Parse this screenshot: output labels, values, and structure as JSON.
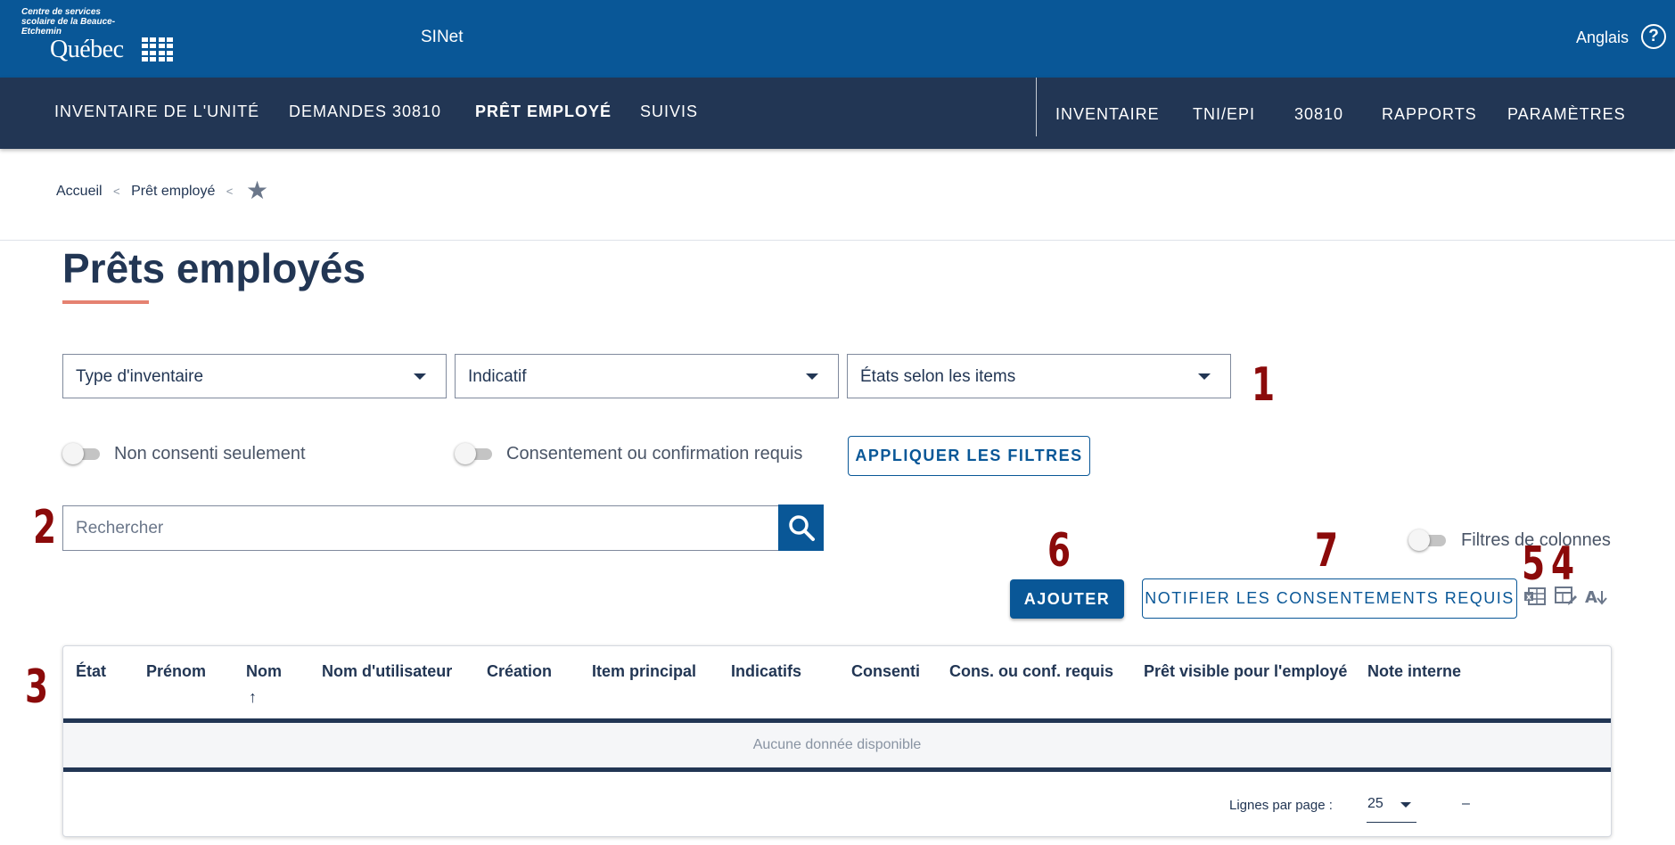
{
  "header": {
    "org_small": "Centre de services scolaire de la Beauce-Etchemin",
    "org_brand": "Québec",
    "app_title": "SINet",
    "language": "Anglais",
    "help_icon": "?"
  },
  "nav": {
    "left": [
      "INVENTAIRE DE L'UNITÉ",
      "DEMANDES 30810",
      "PRÊT EMPLOYÉ",
      "SUIVIS"
    ],
    "right": [
      "INVENTAIRE",
      "TNI/EPI",
      "30810",
      "RAPPORTS",
      "PARAMÈTRES"
    ],
    "active": "PRÊT EMPLOYÉ"
  },
  "breadcrumb": {
    "items": [
      "Accueil",
      "Prêt employé"
    ],
    "separator": "<",
    "star_icon": "★"
  },
  "page": {
    "title": "Prêts employés"
  },
  "filters": {
    "selects": [
      "Type d'inventaire",
      "Indicatif",
      "États selon les items"
    ],
    "toggle_non_consenti": "Non consenti seulement",
    "toggle_consentement": "Consentement ou confirmation requis",
    "apply_button": "APPLIQUER LES FILTRES"
  },
  "search": {
    "placeholder": "Rechercher"
  },
  "column_filters_label": "Filtres de colonnes",
  "actions": {
    "add_button": "AJOUTER",
    "notify_button": "NOTIFIER LES CONSENTEMENTS REQUIS"
  },
  "annotations": [
    "1",
    "2",
    "3",
    "4",
    "5",
    "6",
    "7"
  ],
  "table": {
    "columns": [
      "État",
      "Prénom",
      "Nom",
      "Nom d'utilisateur",
      "Création",
      "Item principal",
      "Indicatifs",
      "Consenti",
      "Cons. ou conf. requis",
      "Prêt visible pour l'employé",
      "Note interne"
    ],
    "sort_arrow": "↑",
    "empty_message": "Aucune donnée disponible",
    "rows_per_page_label": "Lignes par page :",
    "rows_per_page": "25",
    "range": "–"
  },
  "colors": {
    "header_blue": "#095797",
    "nav_dark": "#223654",
    "accent_underline": "#e58271",
    "annotation_red": "#8b0a0a"
  }
}
